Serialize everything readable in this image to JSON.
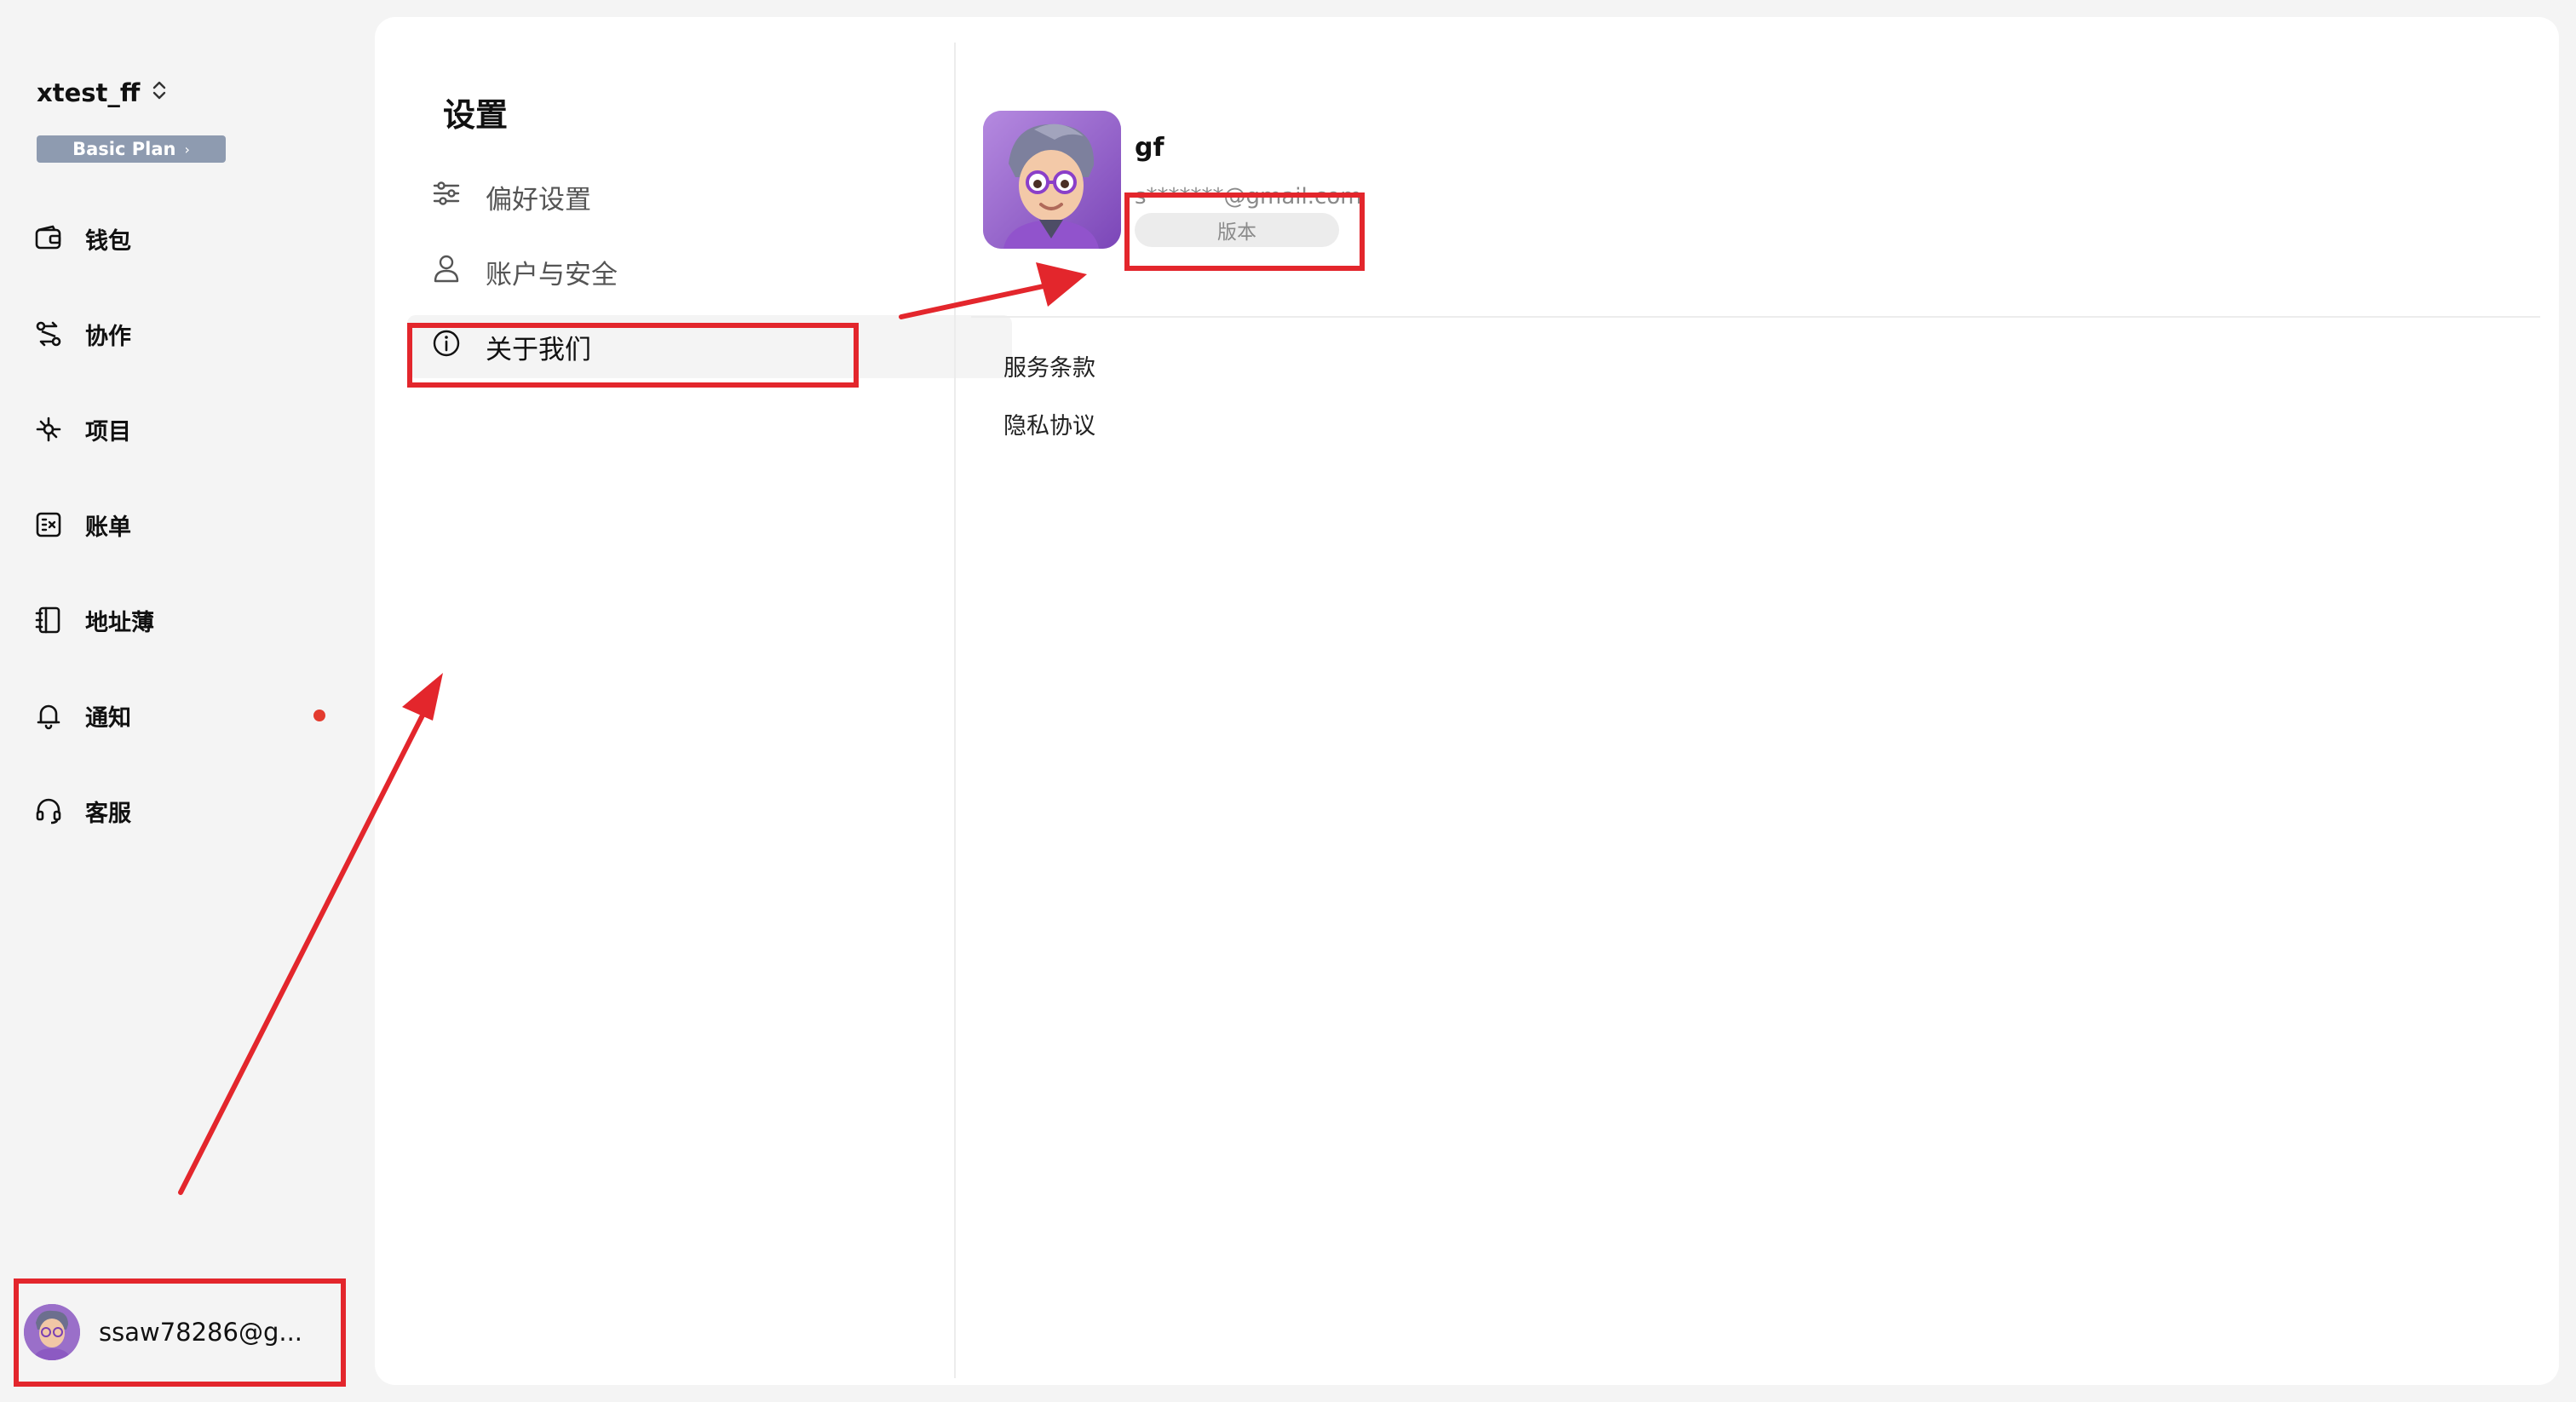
{
  "sidebar": {
    "workspace": "xtest_ff",
    "plan": "Basic Plan",
    "items": [
      {
        "label": "钱包",
        "icon": "wallet-icon"
      },
      {
        "label": "协作",
        "icon": "collaboration-icon"
      },
      {
        "label": "项目",
        "icon": "project-icon"
      },
      {
        "label": "账单",
        "icon": "bill-icon"
      },
      {
        "label": "地址薄",
        "icon": "address-book-icon"
      },
      {
        "label": "通知",
        "icon": "bell-icon",
        "unread_dot": true
      },
      {
        "label": "客服",
        "icon": "headset-icon"
      }
    ],
    "user_email": "ssaw78286@g..."
  },
  "settings": {
    "title": "设置",
    "menu": [
      {
        "label": "偏好设置",
        "icon": "sliders-icon"
      },
      {
        "label": "账户与安全",
        "icon": "user-icon"
      },
      {
        "label": "关于我们",
        "icon": "info-icon",
        "active": true
      }
    ]
  },
  "profile": {
    "name": "gf",
    "email": "s*******@gmail.com",
    "version_label": "版本"
  },
  "links": {
    "terms": "服务条款",
    "privacy": "隐私协议"
  },
  "colors": {
    "highlight": "#e3262c",
    "plan_badge": "#8e9bb0",
    "notification_dot": "#e33b2e"
  }
}
